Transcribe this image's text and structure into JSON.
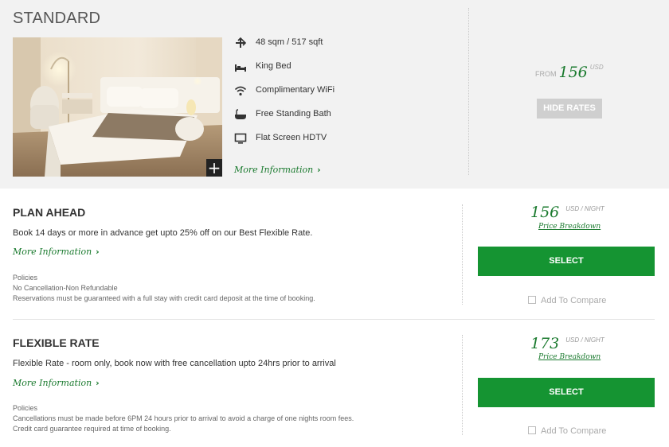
{
  "room": {
    "title": "STANDARD",
    "amenities": [
      {
        "icon": "size-arrows-icon",
        "label": "48 sqm / 517 sqft"
      },
      {
        "icon": "bed-icon",
        "label": "King Bed"
      },
      {
        "icon": "wifi-icon",
        "label": "Complimentary WiFi"
      },
      {
        "icon": "bathtub-icon",
        "label": "Free Standing Bath"
      },
      {
        "icon": "tv-icon",
        "label": "Flat Screen HDTV"
      }
    ],
    "more_info": "More Information",
    "expand_icon": "+",
    "from_label": "FROM",
    "from_price": "156",
    "currency": "USD",
    "hide_rates": "HIDE RATES"
  },
  "rates": [
    {
      "title": "PLAN AHEAD",
      "description": "Book 14 days or more in advance get upto 25% off on our Best Flexible Rate.",
      "more_info": "More Information",
      "policies_label": "Policies",
      "policies": [
        "No Cancellation-Non Refundable",
        "Reservations must be guaranteed with a full stay with credit card deposit at the time of booking."
      ],
      "price": "156",
      "unit": "USD / NIGHT",
      "breakdown": "Price Breakdown",
      "select": "SELECT",
      "compare": "Add To Compare"
    },
    {
      "title": "FLEXIBLE RATE",
      "description": "Flexible Rate - room only, book now with free cancellation upto 24hrs prior to arrival",
      "more_info": "More Information",
      "policies_label": "Policies",
      "policies": [
        "Cancellations must be made before 6PM 24 hours prior to arrival to avoid a charge of one nights room fees.",
        "Credit card guarantee required at time of booking."
      ],
      "price": "173",
      "unit": "USD / NIGHT",
      "breakdown": "Price Breakdown",
      "select": "SELECT",
      "compare": "Add To Compare"
    }
  ],
  "colors": {
    "accent_green": "#159432",
    "price_green": "#1a7a2e",
    "header_bg": "#f2f2f2"
  }
}
